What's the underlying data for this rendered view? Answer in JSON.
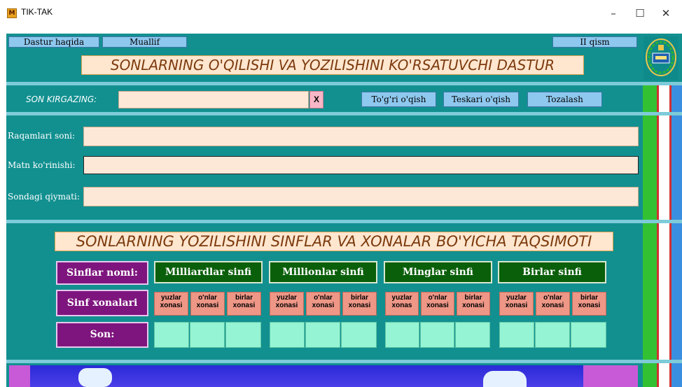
{
  "window": {
    "title": "TIK-TAK",
    "icon_letter": "M",
    "controls": {
      "minimize": "–",
      "maximize": "☐",
      "close": "✕"
    }
  },
  "menu": {
    "about": "Dastur haqida",
    "author": "Muallif",
    "part2": "II qism"
  },
  "banner_title": "SONLARNING O'QILISHI VA YOZILISHINI KO'RSATUVCHI DASTUR",
  "input_row": {
    "label": "SON KIRGAZING:",
    "value": "",
    "clear_label": "X",
    "btn_forward": "To'g'ri o'qish",
    "btn_reverse": "Teskari o'qish",
    "btn_clear": "Tozalash"
  },
  "outputs": {
    "digits_label": "Raqamlari soni:",
    "digits_value": "",
    "text_label": "Matn ko'rinishi:",
    "text_value": "",
    "value_label": "Sondagi qiymati:",
    "value_value": ""
  },
  "section2_title": "SONLARNING YOZILISHINI SINFLAR VA XONALAR BO'YICHA TAQSIMOTI",
  "table": {
    "row_class_names": "Sinflar nomi:",
    "row_places": "Sinf xonalari",
    "row_number": "Son:",
    "classes": [
      "Milliardlar sinfi",
      "Millionlar sinfi",
      "Minglar sinfi",
      "Birlar sinfi"
    ],
    "places": [
      [
        "yuzlar xonasi",
        "o'nlar xonasi",
        "birlar xonasi"
      ],
      [
        "yuzlar xonasi",
        "o'nlar xonasi",
        "birlar xonasi"
      ],
      [
        "yuzlar xonas",
        "o'nlar xonasi",
        "birlar xonasi"
      ],
      [
        "yuzlar xonasi",
        "o'nlar xonasi",
        "birlar xonasi"
      ]
    ]
  },
  "colors": {
    "teal": "#129090",
    "peach": "#fde8d8",
    "purple": "#7e157e",
    "green": "#0a5f0a",
    "salmon": "#ee9787",
    "mint": "#95f4d4"
  }
}
